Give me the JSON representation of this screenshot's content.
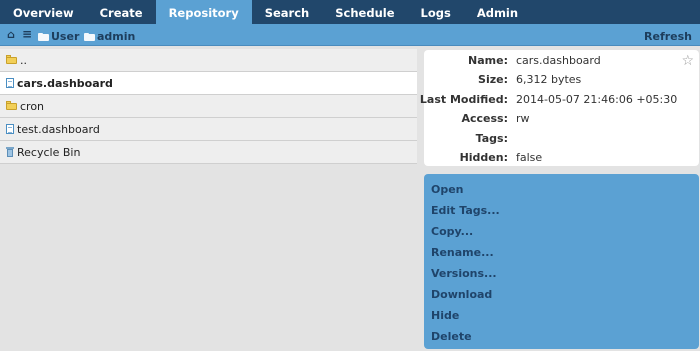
{
  "nav": {
    "tabs": [
      {
        "label": "Overview"
      },
      {
        "label": "Create"
      },
      {
        "label": "Repository"
      },
      {
        "label": "Search"
      },
      {
        "label": "Schedule"
      },
      {
        "label": "Logs"
      },
      {
        "label": "Admin"
      }
    ],
    "active_tab": "Repository"
  },
  "breadcrumb": {
    "home_icon": "⌂",
    "menu_icon": "≡",
    "items": [
      {
        "label": "User"
      },
      {
        "label": "admin"
      }
    ],
    "refresh_label": "Refresh"
  },
  "files": [
    {
      "name": "..",
      "icon": "folder-icon"
    },
    {
      "name": "cars.dashboard",
      "icon": "dashboard-file-icon",
      "selected": true
    },
    {
      "name": "cron",
      "icon": "folder-icon"
    },
    {
      "name": "test.dashboard",
      "icon": "dashboard-file-icon"
    },
    {
      "name": "Recycle Bin",
      "icon": "recycle-bin-icon"
    }
  ],
  "properties": {
    "name_label": "Name:",
    "name_value": "cars.dashboard",
    "size_label": "Size:",
    "size_value": "6,312 bytes",
    "modified_label": "Last Modified:",
    "modified_value": "2014-05-07 21:46:06 +05:30",
    "access_label": "Access:",
    "access_value": "rw",
    "tags_label": "Tags:",
    "tags_value": "",
    "hidden_label": "Hidden:",
    "hidden_value": "false",
    "star_icon": "☆"
  },
  "actions": [
    {
      "label": "Open"
    },
    {
      "label": "Edit Tags..."
    },
    {
      "label": "Copy..."
    },
    {
      "label": "Rename..."
    },
    {
      "label": "Versions..."
    },
    {
      "label": "Download"
    },
    {
      "label": "Hide"
    },
    {
      "label": "Delete"
    }
  ],
  "colors": {
    "nav_bg": "#21476b",
    "accent": "#5ba1d3",
    "action_text": "#1f446a"
  }
}
